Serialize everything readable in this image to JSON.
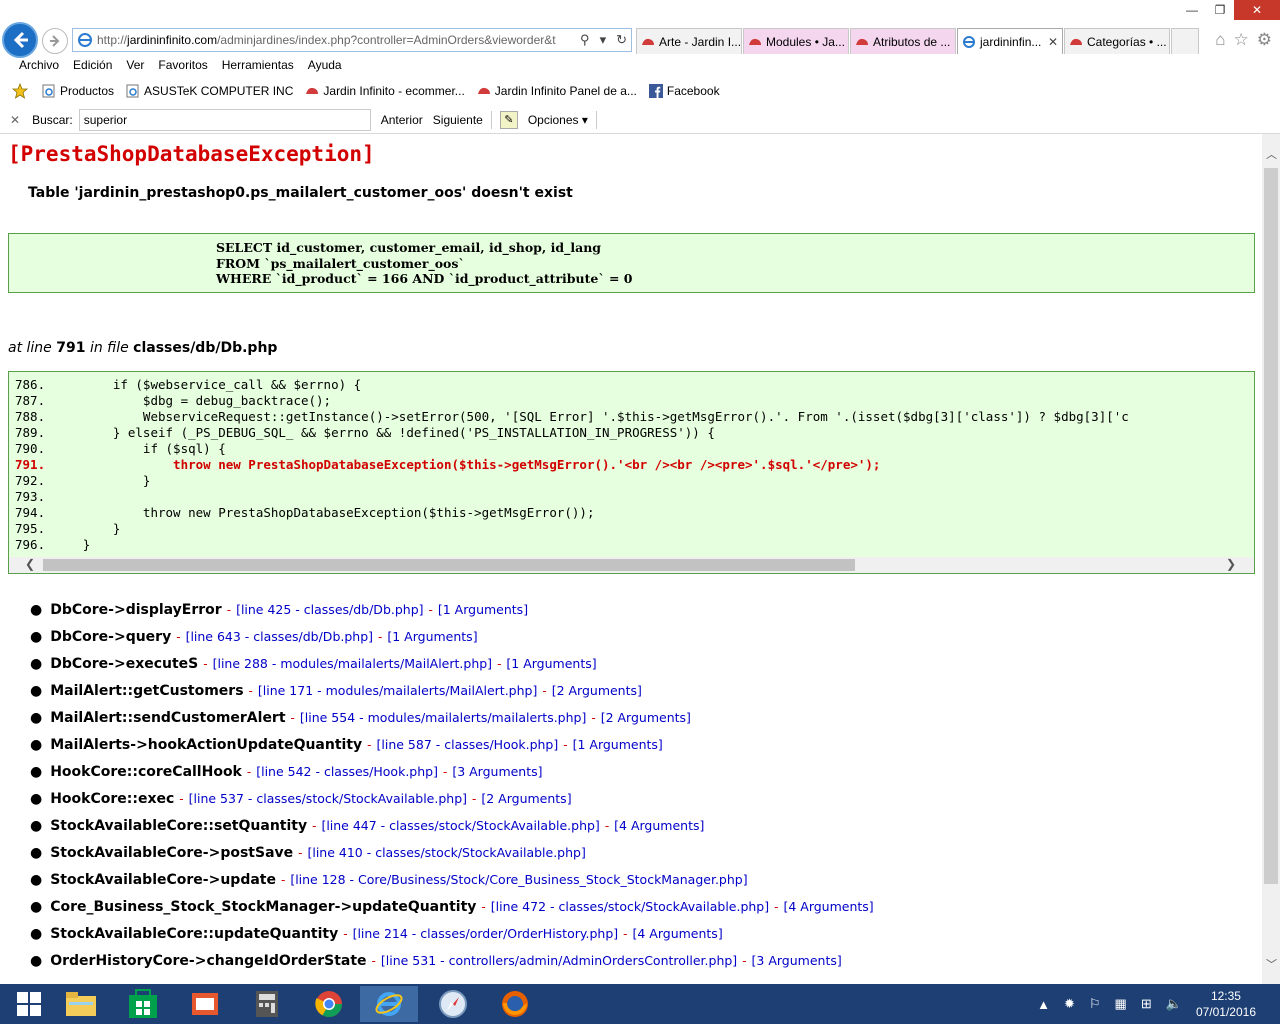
{
  "browser": {
    "url_prefix": "http://",
    "url_host": "jardininfinito.com",
    "url_path": "/adminjardines/index.php?controller=AdminOrders&vieworder&t",
    "tabs": [
      {
        "label": "Arte - Jardin I...",
        "active": false
      },
      {
        "label": "Modules • Ja...",
        "active": false
      },
      {
        "label": "Atributos de ...",
        "active": false
      },
      {
        "label": "jardininfin...",
        "active": true
      },
      {
        "label": "Categorías • ...",
        "active": false
      }
    ],
    "tab_close": "✕",
    "menu": [
      "Archivo",
      "Edición",
      "Ver",
      "Favoritos",
      "Herramientas",
      "Ayuda"
    ],
    "favorites": [
      "Productos",
      "ASUSTeK COMPUTER INC",
      "Jardin Infinito - ecommer...",
      "Jardin Infinito  Panel de a...",
      "Facebook"
    ],
    "find": {
      "label": "Buscar:",
      "value": "superior",
      "prev": "Anterior",
      "next": "Siguiente",
      "options": "Opciones"
    }
  },
  "error": {
    "title": "[PrestaShopDatabaseException]",
    "message": "Table 'jardinin_prestashop0.ps_mailalert_customer_oos' doesn't exist",
    "sql": "SELECT id_customer, customer_email, id_shop, id_lang\nFROM `ps_mailalert_customer_oos`\nWHERE `id_product` = 166 AND `id_product_attribute` = 0",
    "at_prefix": "at line",
    "line": "791",
    "in_file": "in file",
    "file": "classes/db/Db.php",
    "code_lines": [
      "786.         if ($webservice_call && $errno) {",
      "787.             $dbg = debug_backtrace();",
      "788.             WebserviceRequest::getInstance()->setError(500, '[SQL Error] '.$this->getMsgError().'. From '.(isset($dbg[3]['class']) ? $dbg[3]['c",
      "789.         } elseif (_PS_DEBUG_SQL_ && $errno && !defined('PS_INSTALLATION_IN_PROGRESS')) {",
      "790.             if ($sql) {",
      "791.                 throw new PrestaShopDatabaseException($this->getMsgError().'<br /><br /><pre>'.$sql.'</pre>');",
      "792.             }",
      "793.",
      "794.             throw new PrestaShopDatabaseException($this->getMsgError());",
      "795.         }",
      "796.     }"
    ],
    "error_line_index": 5
  },
  "trace": [
    {
      "fn": "DbCore->displayError",
      "loc": "[line 425 - classes/db/Db.php]",
      "args": "[1 Arguments]"
    },
    {
      "fn": "DbCore->query",
      "loc": "[line 643 - classes/db/Db.php]",
      "args": "[1 Arguments]"
    },
    {
      "fn": "DbCore->executeS",
      "loc": "[line 288 - modules/mailalerts/MailAlert.php]",
      "args": "[1 Arguments]"
    },
    {
      "fn": "MailAlert::getCustomers",
      "loc": "[line 171 - modules/mailalerts/MailAlert.php]",
      "args": "[2 Arguments]"
    },
    {
      "fn": "MailAlert::sendCustomerAlert",
      "loc": "[line 554 - modules/mailalerts/mailalerts.php]",
      "args": "[2 Arguments]"
    },
    {
      "fn": "MailAlerts->hookActionUpdateQuantity",
      "loc": "[line 587 - classes/Hook.php]",
      "args": "[1 Arguments]"
    },
    {
      "fn": "HookCore::coreCallHook",
      "loc": "[line 542 - classes/Hook.php]",
      "args": "[3 Arguments]"
    },
    {
      "fn": "HookCore::exec",
      "loc": "[line 537 - classes/stock/StockAvailable.php]",
      "args": "[2 Arguments]"
    },
    {
      "fn": "StockAvailableCore::setQuantity",
      "loc": "[line 447 - classes/stock/StockAvailable.php]",
      "args": "[4 Arguments]"
    },
    {
      "fn": "StockAvailableCore->postSave",
      "loc": "[line 410 - classes/stock/StockAvailable.php]",
      "args": ""
    },
    {
      "fn": "StockAvailableCore->update",
      "loc": "[line 128 - Core/Business/Stock/Core_Business_Stock_StockManager.php]",
      "args": ""
    },
    {
      "fn": "Core_Business_Stock_StockManager->updateQuantity",
      "loc": "[line 472 - classes/stock/StockAvailable.php]",
      "args": "[4 Arguments]"
    },
    {
      "fn": "StockAvailableCore::updateQuantity",
      "loc": "[line 214 - classes/order/OrderHistory.php]",
      "args": "[4 Arguments]"
    },
    {
      "fn": "OrderHistoryCore->changeIdOrderState",
      "loc": "[line 531 - controllers/admin/AdminOrdersController.php]",
      "args": "[3 Arguments]"
    }
  ],
  "taskbar": {
    "time": "12:35",
    "date": "07/01/2016"
  },
  "colors": {
    "error_red": "#d20000",
    "code_bg": "#e6ffde",
    "link_blue": "#0000c8",
    "taskbar": "#1d3f73"
  }
}
